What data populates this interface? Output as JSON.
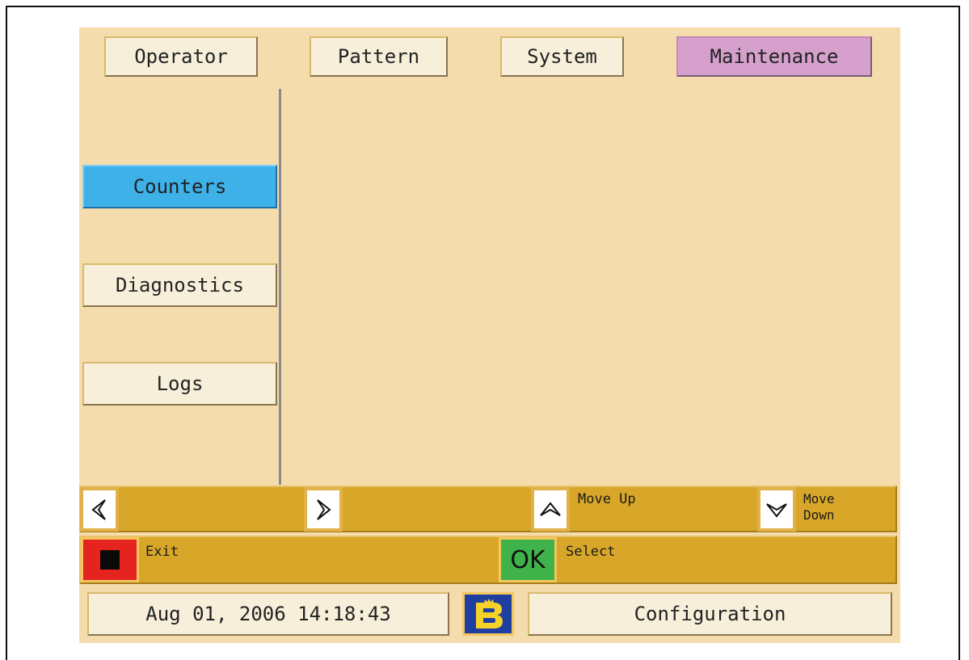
{
  "tabs": [
    {
      "label": "Operator",
      "active": false
    },
    {
      "label": "Pattern",
      "active": false
    },
    {
      "label": "System",
      "active": false
    },
    {
      "label": "Maintenance",
      "active": true
    }
  ],
  "sidebar": {
    "items": [
      {
        "label": "Counters",
        "active": true
      },
      {
        "label": "Diagnostics",
        "active": false
      },
      {
        "label": "Logs",
        "active": false
      }
    ]
  },
  "softkeys": {
    "left_icon": "arrow-left-icon",
    "right_icon": "arrow-right-icon",
    "up_icon": "arrow-up-icon",
    "up_label": "Move Up",
    "down_icon": "arrow-down-icon",
    "down_label_line1": "Move",
    "down_label_line2": "Down",
    "exit_icon": "stop-icon",
    "exit_label": "Exit",
    "ok_icon_text": "OK",
    "select_label": "Select"
  },
  "status": {
    "datetime": "Aug 01, 2006 14:18:43",
    "logo": "brand-logo-icon",
    "mode": "Configuration"
  },
  "colors": {
    "panel_bg": "#f5dcad",
    "active_tab": "#d6a0cc",
    "active_item": "#3db1e8",
    "softkey_bar": "#d8a629",
    "exit_key": "#e52420",
    "ok_key": "#3fb34a",
    "logo_blue": "#1f3fa0",
    "logo_yellow": "#f5d12a"
  }
}
